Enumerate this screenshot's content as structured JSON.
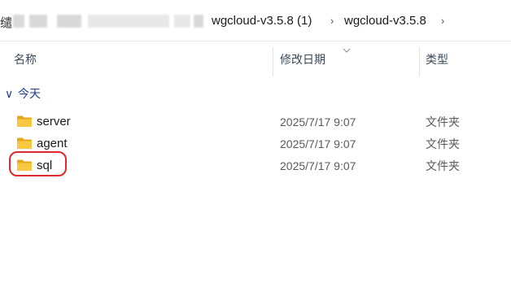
{
  "breadcrumb": {
    "edge_glyph": "缱",
    "items": [
      "wgcloud-v3.5.8 (1)",
      "wgcloud-v3.5.8"
    ],
    "separator": "›"
  },
  "columns": {
    "name": "名称",
    "modified": "修改日期",
    "type": "类型"
  },
  "group": {
    "label": "今天",
    "chevron": "∨"
  },
  "rows": [
    {
      "name": "server",
      "date": "2025/7/17 9:07",
      "type": "文件夹"
    },
    {
      "name": "agent",
      "date": "2025/7/17 9:07",
      "type": "文件夹"
    },
    {
      "name": "sql",
      "date": "2025/7/17 9:07",
      "type": "文件夹"
    }
  ],
  "colors": {
    "folder_yellow": "#f8c843",
    "folder_dark": "#e6a817",
    "highlight": "#e0292c",
    "group_text": "#1e3e8c"
  },
  "icons": {
    "folder": "folder-icon",
    "sort": "sort-caret-icon",
    "group_toggle": "chevron-down-icon",
    "crumb_sep": "chevron-right-icon"
  }
}
